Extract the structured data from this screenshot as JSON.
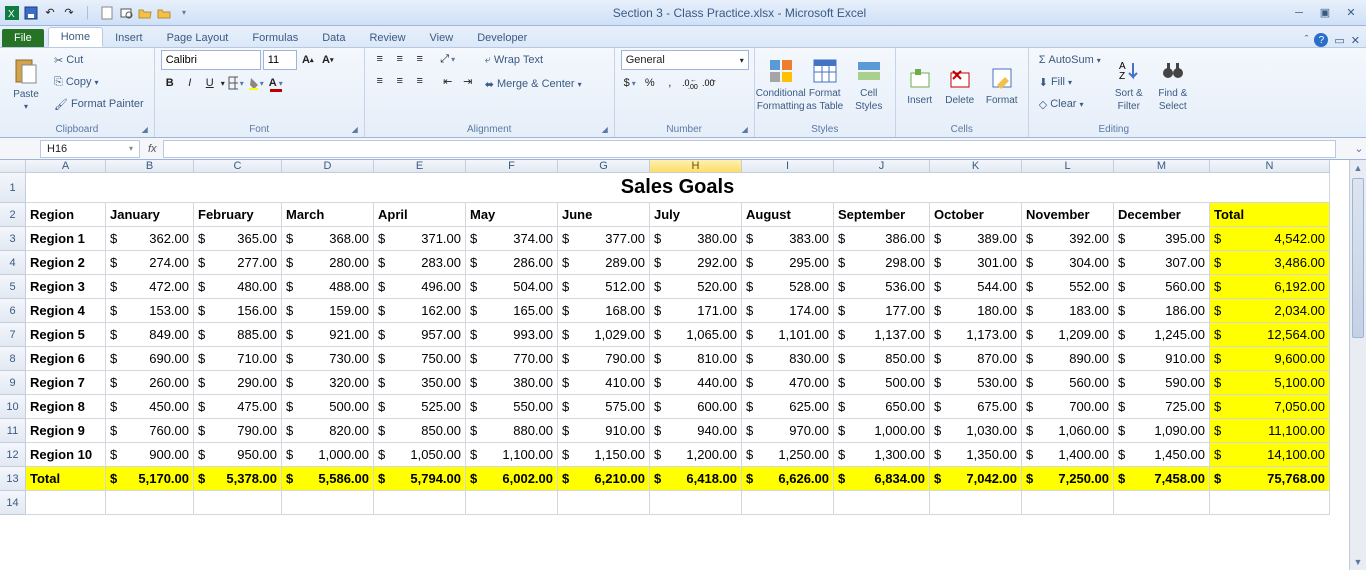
{
  "window": {
    "title": "Section 3 - Class Practice.xlsx - Microsoft Excel"
  },
  "tabs": {
    "file": "File",
    "home": "Home",
    "insert": "Insert",
    "page_layout": "Page Layout",
    "formulas": "Formulas",
    "data": "Data",
    "review": "Review",
    "view": "View",
    "developer": "Developer"
  },
  "ribbon": {
    "clipboard": {
      "label": "Clipboard",
      "paste": "Paste",
      "cut": "Cut",
      "copy": "Copy",
      "format_painter": "Format Painter"
    },
    "font": {
      "label": "Font",
      "name": "Calibri",
      "size": "11"
    },
    "alignment": {
      "label": "Alignment",
      "wrap": "Wrap Text",
      "merge": "Merge & Center"
    },
    "number": {
      "label": "Number",
      "format": "General"
    },
    "styles": {
      "label": "Styles",
      "cond": "Conditional",
      "cond2": "Formatting",
      "table": "Format",
      "table2": "as Table",
      "cell": "Cell",
      "cell2": "Styles"
    },
    "cells": {
      "label": "Cells",
      "insert": "Insert",
      "delete": "Delete",
      "format": "Format"
    },
    "editing": {
      "label": "Editing",
      "autosum": "AutoSum",
      "fill": "Fill",
      "clear": "Clear",
      "sort": "Sort &",
      "sort2": "Filter",
      "find": "Find &",
      "find2": "Select"
    }
  },
  "namebox": "H16",
  "chart_data": {
    "type": "table",
    "title": "Sales Goals",
    "columns": [
      "A",
      "B",
      "C",
      "D",
      "E",
      "F",
      "G",
      "H",
      "I",
      "J",
      "K",
      "L",
      "M",
      "N"
    ],
    "headers": [
      "Region",
      "January",
      "February",
      "March",
      "April",
      "May",
      "June",
      "July",
      "August",
      "September",
      "October",
      "November",
      "December",
      "Total"
    ],
    "rows": [
      {
        "label": "Region 1",
        "values": [
          "362.00",
          "365.00",
          "368.00",
          "371.00",
          "374.00",
          "377.00",
          "380.00",
          "383.00",
          "386.00",
          "389.00",
          "392.00",
          "395.00"
        ],
        "total": "4,542.00"
      },
      {
        "label": "Region 2",
        "values": [
          "274.00",
          "277.00",
          "280.00",
          "283.00",
          "286.00",
          "289.00",
          "292.00",
          "295.00",
          "298.00",
          "301.00",
          "304.00",
          "307.00"
        ],
        "total": "3,486.00"
      },
      {
        "label": "Region 3",
        "values": [
          "472.00",
          "480.00",
          "488.00",
          "496.00",
          "504.00",
          "512.00",
          "520.00",
          "528.00",
          "536.00",
          "544.00",
          "552.00",
          "560.00"
        ],
        "total": "6,192.00"
      },
      {
        "label": "Region 4",
        "values": [
          "153.00",
          "156.00",
          "159.00",
          "162.00",
          "165.00",
          "168.00",
          "171.00",
          "174.00",
          "177.00",
          "180.00",
          "183.00",
          "186.00"
        ],
        "total": "2,034.00"
      },
      {
        "label": "Region 5",
        "values": [
          "849.00",
          "885.00",
          "921.00",
          "957.00",
          "993.00",
          "1,029.00",
          "1,065.00",
          "1,101.00",
          "1,137.00",
          "1,173.00",
          "1,209.00",
          "1,245.00"
        ],
        "total": "12,564.00"
      },
      {
        "label": "Region 6",
        "values": [
          "690.00",
          "710.00",
          "730.00",
          "750.00",
          "770.00",
          "790.00",
          "810.00",
          "830.00",
          "850.00",
          "870.00",
          "890.00",
          "910.00"
        ],
        "total": "9,600.00"
      },
      {
        "label": "Region 7",
        "values": [
          "260.00",
          "290.00",
          "320.00",
          "350.00",
          "380.00",
          "410.00",
          "440.00",
          "470.00",
          "500.00",
          "530.00",
          "560.00",
          "590.00"
        ],
        "total": "5,100.00"
      },
      {
        "label": "Region 8",
        "values": [
          "450.00",
          "475.00",
          "500.00",
          "525.00",
          "550.00",
          "575.00",
          "600.00",
          "625.00",
          "650.00",
          "675.00",
          "700.00",
          "725.00"
        ],
        "total": "7,050.00"
      },
      {
        "label": "Region 9",
        "values": [
          "760.00",
          "790.00",
          "820.00",
          "850.00",
          "880.00",
          "910.00",
          "940.00",
          "970.00",
          "1,000.00",
          "1,030.00",
          "1,060.00",
          "1,090.00"
        ],
        "total": "11,100.00"
      },
      {
        "label": "Region 10",
        "values": [
          "900.00",
          "950.00",
          "1,000.00",
          "1,050.00",
          "1,100.00",
          "1,150.00",
          "1,200.00",
          "1,250.00",
          "1,300.00",
          "1,350.00",
          "1,400.00",
          "1,450.00"
        ],
        "total": "14,100.00"
      }
    ],
    "totals": {
      "label": "Total",
      "values": [
        "5,170.00",
        "5,378.00",
        "5,586.00",
        "5,794.00",
        "6,002.00",
        "6,210.00",
        "6,418.00",
        "6,626.00",
        "6,834.00",
        "7,042.00",
        "7,250.00",
        "7,458.00"
      ],
      "total": "75,768.00"
    },
    "row_numbers": [
      "1",
      "2",
      "3",
      "4",
      "5",
      "6",
      "7",
      "8",
      "9",
      "10",
      "11",
      "12",
      "13",
      "14"
    ]
  }
}
